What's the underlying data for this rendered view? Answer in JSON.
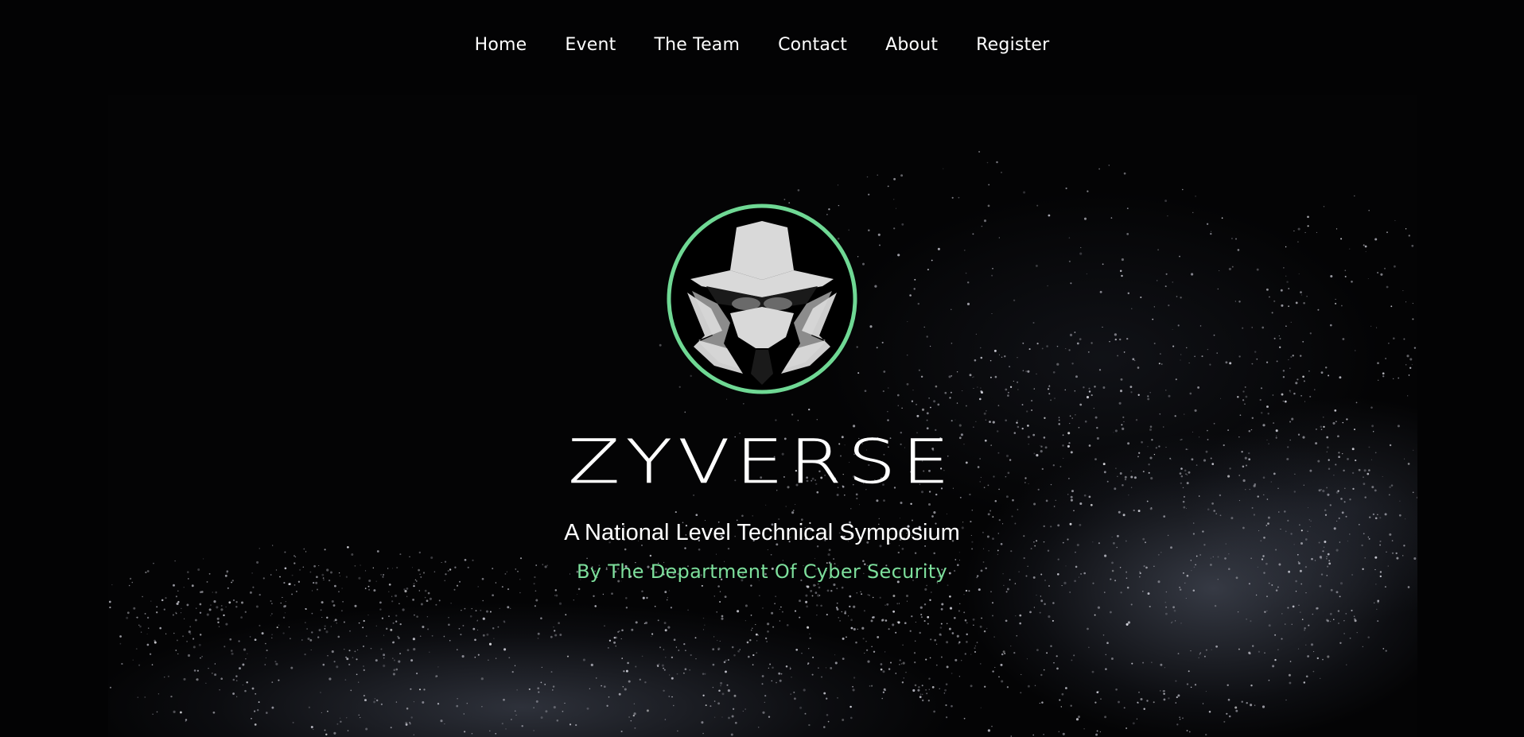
{
  "nav": {
    "items": [
      {
        "label": "Home"
      },
      {
        "label": "Event"
      },
      {
        "label": "The Team"
      },
      {
        "label": "Contact"
      },
      {
        "label": "About"
      },
      {
        "label": "Register"
      }
    ]
  },
  "hero": {
    "logo_icon": "hooded-spy-icon",
    "title": "ZYVERSE",
    "subtitle": "A National Level Technical Symposium",
    "tagline": "By The Department Of Cyber Security"
  },
  "colors": {
    "background": "#030304",
    "accent": "#7ddf9c",
    "logo_ring": "#6fd894",
    "logo_fill": "#d9d9d9"
  }
}
